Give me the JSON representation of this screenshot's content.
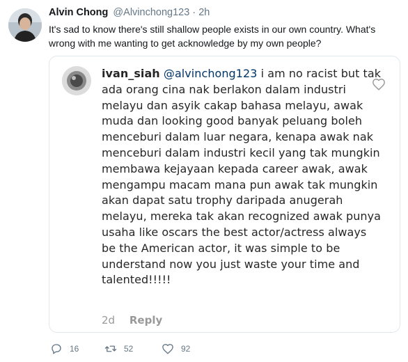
{
  "tweet": {
    "author_name": "Alvin Chong",
    "author_handle": "@Alvinchong123",
    "separator": "·",
    "time": "2h",
    "text": "It's sad to know there's still shallow people exists in our own country. What's wrong with me wanting to get acknowledge by my own people?",
    "avatar_icon": "user-avatar"
  },
  "embedded_comment": {
    "username": "ivan_siah",
    "mention": "@alvinchong123",
    "text": " i am no racist but tak ada orang cina nak berlakon dalam industri melayu dan asyik cakap bahasa melayu, awak muda dan looking good banyak peluang boleh menceburi dalam luar negara, kenapa awak nak menceburi dalam industri kecil yang tak mungkin membawa kejayaan kepada career awak, awak mengampu macam mana pun awak tak mungkin akan dapat satu trophy daripada anugerah melayu, mereka tak akan recognized awak punya usaha like oscars the best actor/actress always be the American actor,  it was simple to be understand now you just waste your time and talented!!!!!",
    "age": "2d",
    "reply_label": "Reply",
    "like_icon": "heart-outline-icon"
  },
  "actions": {
    "reply_count": "16",
    "retweet_count": "52",
    "like_count": "92"
  },
  "colors": {
    "text": "#14171a",
    "muted": "#657786",
    "border": "#e1e8ed",
    "mention": "#003569"
  }
}
